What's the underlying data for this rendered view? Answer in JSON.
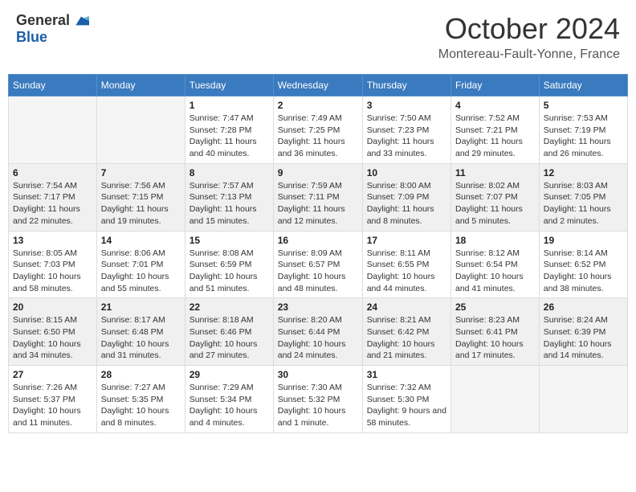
{
  "logo": {
    "general": "General",
    "blue": "Blue"
  },
  "title": "October 2024",
  "location": "Montereau-Fault-Yonne, France",
  "headers": [
    "Sunday",
    "Monday",
    "Tuesday",
    "Wednesday",
    "Thursday",
    "Friday",
    "Saturday"
  ],
  "weeks": [
    [
      {
        "day": "",
        "info": ""
      },
      {
        "day": "",
        "info": ""
      },
      {
        "day": "1",
        "sunrise": "Sunrise: 7:47 AM",
        "sunset": "Sunset: 7:28 PM",
        "daylight": "Daylight: 11 hours and 40 minutes."
      },
      {
        "day": "2",
        "sunrise": "Sunrise: 7:49 AM",
        "sunset": "Sunset: 7:25 PM",
        "daylight": "Daylight: 11 hours and 36 minutes."
      },
      {
        "day": "3",
        "sunrise": "Sunrise: 7:50 AM",
        "sunset": "Sunset: 7:23 PM",
        "daylight": "Daylight: 11 hours and 33 minutes."
      },
      {
        "day": "4",
        "sunrise": "Sunrise: 7:52 AM",
        "sunset": "Sunset: 7:21 PM",
        "daylight": "Daylight: 11 hours and 29 minutes."
      },
      {
        "day": "5",
        "sunrise": "Sunrise: 7:53 AM",
        "sunset": "Sunset: 7:19 PM",
        "daylight": "Daylight: 11 hours and 26 minutes."
      }
    ],
    [
      {
        "day": "6",
        "sunrise": "Sunrise: 7:54 AM",
        "sunset": "Sunset: 7:17 PM",
        "daylight": "Daylight: 11 hours and 22 minutes."
      },
      {
        "day": "7",
        "sunrise": "Sunrise: 7:56 AM",
        "sunset": "Sunset: 7:15 PM",
        "daylight": "Daylight: 11 hours and 19 minutes."
      },
      {
        "day": "8",
        "sunrise": "Sunrise: 7:57 AM",
        "sunset": "Sunset: 7:13 PM",
        "daylight": "Daylight: 11 hours and 15 minutes."
      },
      {
        "day": "9",
        "sunrise": "Sunrise: 7:59 AM",
        "sunset": "Sunset: 7:11 PM",
        "daylight": "Daylight: 11 hours and 12 minutes."
      },
      {
        "day": "10",
        "sunrise": "Sunrise: 8:00 AM",
        "sunset": "Sunset: 7:09 PM",
        "daylight": "Daylight: 11 hours and 8 minutes."
      },
      {
        "day": "11",
        "sunrise": "Sunrise: 8:02 AM",
        "sunset": "Sunset: 7:07 PM",
        "daylight": "Daylight: 11 hours and 5 minutes."
      },
      {
        "day": "12",
        "sunrise": "Sunrise: 8:03 AM",
        "sunset": "Sunset: 7:05 PM",
        "daylight": "Daylight: 11 hours and 2 minutes."
      }
    ],
    [
      {
        "day": "13",
        "sunrise": "Sunrise: 8:05 AM",
        "sunset": "Sunset: 7:03 PM",
        "daylight": "Daylight: 10 hours and 58 minutes."
      },
      {
        "day": "14",
        "sunrise": "Sunrise: 8:06 AM",
        "sunset": "Sunset: 7:01 PM",
        "daylight": "Daylight: 10 hours and 55 minutes."
      },
      {
        "day": "15",
        "sunrise": "Sunrise: 8:08 AM",
        "sunset": "Sunset: 6:59 PM",
        "daylight": "Daylight: 10 hours and 51 minutes."
      },
      {
        "day": "16",
        "sunrise": "Sunrise: 8:09 AM",
        "sunset": "Sunset: 6:57 PM",
        "daylight": "Daylight: 10 hours and 48 minutes."
      },
      {
        "day": "17",
        "sunrise": "Sunrise: 8:11 AM",
        "sunset": "Sunset: 6:55 PM",
        "daylight": "Daylight: 10 hours and 44 minutes."
      },
      {
        "day": "18",
        "sunrise": "Sunrise: 8:12 AM",
        "sunset": "Sunset: 6:54 PM",
        "daylight": "Daylight: 10 hours and 41 minutes."
      },
      {
        "day": "19",
        "sunrise": "Sunrise: 8:14 AM",
        "sunset": "Sunset: 6:52 PM",
        "daylight": "Daylight: 10 hours and 38 minutes."
      }
    ],
    [
      {
        "day": "20",
        "sunrise": "Sunrise: 8:15 AM",
        "sunset": "Sunset: 6:50 PM",
        "daylight": "Daylight: 10 hours and 34 minutes."
      },
      {
        "day": "21",
        "sunrise": "Sunrise: 8:17 AM",
        "sunset": "Sunset: 6:48 PM",
        "daylight": "Daylight: 10 hours and 31 minutes."
      },
      {
        "day": "22",
        "sunrise": "Sunrise: 8:18 AM",
        "sunset": "Sunset: 6:46 PM",
        "daylight": "Daylight: 10 hours and 27 minutes."
      },
      {
        "day": "23",
        "sunrise": "Sunrise: 8:20 AM",
        "sunset": "Sunset: 6:44 PM",
        "daylight": "Daylight: 10 hours and 24 minutes."
      },
      {
        "day": "24",
        "sunrise": "Sunrise: 8:21 AM",
        "sunset": "Sunset: 6:42 PM",
        "daylight": "Daylight: 10 hours and 21 minutes."
      },
      {
        "day": "25",
        "sunrise": "Sunrise: 8:23 AM",
        "sunset": "Sunset: 6:41 PM",
        "daylight": "Daylight: 10 hours and 17 minutes."
      },
      {
        "day": "26",
        "sunrise": "Sunrise: 8:24 AM",
        "sunset": "Sunset: 6:39 PM",
        "daylight": "Daylight: 10 hours and 14 minutes."
      }
    ],
    [
      {
        "day": "27",
        "sunrise": "Sunrise: 7:26 AM",
        "sunset": "Sunset: 5:37 PM",
        "daylight": "Daylight: 10 hours and 11 minutes."
      },
      {
        "day": "28",
        "sunrise": "Sunrise: 7:27 AM",
        "sunset": "Sunset: 5:35 PM",
        "daylight": "Daylight: 10 hours and 8 minutes."
      },
      {
        "day": "29",
        "sunrise": "Sunrise: 7:29 AM",
        "sunset": "Sunset: 5:34 PM",
        "daylight": "Daylight: 10 hours and 4 minutes."
      },
      {
        "day": "30",
        "sunrise": "Sunrise: 7:30 AM",
        "sunset": "Sunset: 5:32 PM",
        "daylight": "Daylight: 10 hours and 1 minute."
      },
      {
        "day": "31",
        "sunrise": "Sunrise: 7:32 AM",
        "sunset": "Sunset: 5:30 PM",
        "daylight": "Daylight: 9 hours and 58 minutes."
      },
      {
        "day": "",
        "info": ""
      },
      {
        "day": "",
        "info": ""
      }
    ]
  ]
}
